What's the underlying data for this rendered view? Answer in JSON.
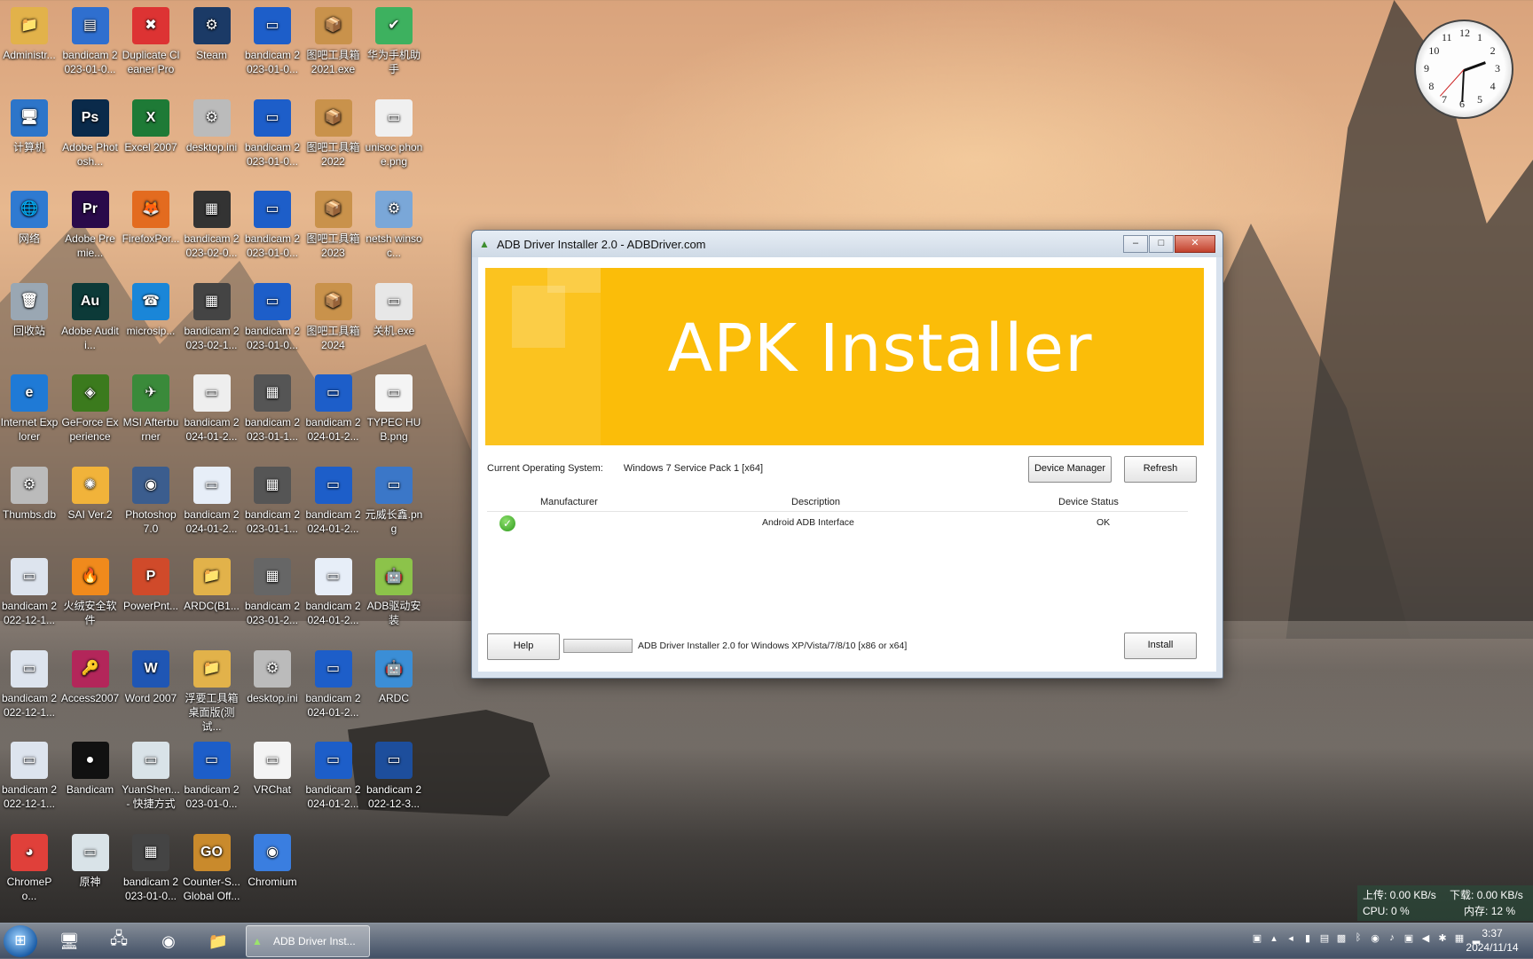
{
  "desktop": {
    "icons": [
      {
        "label": "Administr...",
        "glyph": "📁",
        "bg": "#e2b24a"
      },
      {
        "label": "bandicam 2023-01-0...",
        "glyph": "▤",
        "bg": "#2f6fcf"
      },
      {
        "label": "Duplicate Cleaner Pro",
        "glyph": "✖",
        "bg": "#d33"
      },
      {
        "label": "Steam",
        "glyph": "⚙",
        "bg": "#1b3a66"
      },
      {
        "label": "bandicam 2023-01-0...",
        "glyph": "▭",
        "bg": "#1d5ec9"
      },
      {
        "label": "图吧工具箱 2021.exe",
        "glyph": "📦",
        "bg": "#c9924b"
      },
      {
        "label": "华为手机助手",
        "glyph": "✔",
        "bg": "#3db15f"
      },
      {
        "label": "计算机",
        "glyph": "🖥",
        "bg": "#2d75c9"
      },
      {
        "label": "Adobe Photosh...",
        "glyph": "Ps",
        "bg": "#0a2a4a"
      },
      {
        "label": "Excel 2007",
        "glyph": "X",
        "bg": "#1e7a36"
      },
      {
        "label": "desktop.ini",
        "glyph": "⚙",
        "bg": "#bbbbbb"
      },
      {
        "label": "bandicam 2023-01-0...",
        "glyph": "▭",
        "bg": "#1d5ec9"
      },
      {
        "label": "图吧工具箱 2022",
        "glyph": "📦",
        "bg": "#c9924b"
      },
      {
        "label": "unisoc phone.png",
        "glyph": "▭",
        "bg": "#f0f0f0"
      },
      {
        "label": "网络",
        "glyph": "🌐",
        "bg": "#2f7ad1"
      },
      {
        "label": "Adobe Premie...",
        "glyph": "Pr",
        "bg": "#2a0a4a"
      },
      {
        "label": "FirefoxPor...",
        "glyph": "🦊",
        "bg": "#e36b1f"
      },
      {
        "label": "bandicam 2023-02-0...",
        "glyph": "▦",
        "bg": "#333"
      },
      {
        "label": "bandicam 2023-01-0...",
        "glyph": "▭",
        "bg": "#1d5ec9"
      },
      {
        "label": "图吧工具箱 2023",
        "glyph": "📦",
        "bg": "#c9924b"
      },
      {
        "label": "netsh winsoc...",
        "glyph": "⚙",
        "bg": "#7aa7d8"
      },
      {
        "label": "回收站",
        "glyph": "🗑",
        "bg": "#9aa7b3"
      },
      {
        "label": "Adobe Auditi...",
        "glyph": "Au",
        "bg": "#0c3a38"
      },
      {
        "label": "microsip...",
        "glyph": "☎",
        "bg": "#1a86d8"
      },
      {
        "label": "bandicam 2023-02-1...",
        "glyph": "▦",
        "bg": "#444"
      },
      {
        "label": "bandicam 2023-01-0...",
        "glyph": "▭",
        "bg": "#1d5ec9"
      },
      {
        "label": "图吧工具箱 2024",
        "glyph": "📦",
        "bg": "#c9924b"
      },
      {
        "label": "关机.exe",
        "glyph": "▭",
        "bg": "#e7e7e7"
      },
      {
        "label": "Internet Explorer",
        "glyph": "e",
        "bg": "#1f7ad6"
      },
      {
        "label": "GeForce Experience",
        "glyph": "◈",
        "bg": "#3b7a1d"
      },
      {
        "label": "MSI Afterburner",
        "glyph": "✈",
        "bg": "#3a8a3a"
      },
      {
        "label": "bandicam 2024-01-2...",
        "glyph": "▭",
        "bg": "#eeeeee"
      },
      {
        "label": "bandicam 2023-01-1...",
        "glyph": "▦",
        "bg": "#555"
      },
      {
        "label": "bandicam 2024-01-2...",
        "glyph": "▭",
        "bg": "#1d5ec9"
      },
      {
        "label": "TYPEC HUB.png",
        "glyph": "▭",
        "bg": "#f4f4f4"
      },
      {
        "label": "Thumbs.db",
        "glyph": "⚙",
        "bg": "#bbbbbb"
      },
      {
        "label": "SAI Ver.2",
        "glyph": "✺",
        "bg": "#f1b33a"
      },
      {
        "label": "Photoshop 7.0",
        "glyph": "◉",
        "bg": "#3b5d8e"
      },
      {
        "label": "bandicam 2024-01-2...",
        "glyph": "▭",
        "bg": "#e7eef8"
      },
      {
        "label": "bandicam 2023-01-1...",
        "glyph": "▦",
        "bg": "#555"
      },
      {
        "label": "bandicam 2024-01-2...",
        "glyph": "▭",
        "bg": "#1d5ec9"
      },
      {
        "label": "元威长鑫.png",
        "glyph": "▭",
        "bg": "#3b77c8"
      },
      {
        "label": "bandicam 2022-12-1...",
        "glyph": "▭",
        "bg": "#dde4ee"
      },
      {
        "label": "火绒安全软件",
        "glyph": "🔥",
        "bg": "#f08a1c"
      },
      {
        "label": "PowerPnt...",
        "glyph": "P",
        "bg": "#d04a2a"
      },
      {
        "label": "ARDC(B1...",
        "glyph": "📁",
        "bg": "#e2b24a"
      },
      {
        "label": "bandicam 2023-01-2...",
        "glyph": "▦",
        "bg": "#666"
      },
      {
        "label": "bandicam 2024-01-2...",
        "glyph": "▭",
        "bg": "#e7eef8"
      },
      {
        "label": "ADB驱动安装",
        "glyph": "🤖",
        "bg": "#8cc34a"
      },
      {
        "label": "bandicam 2022-12-1...",
        "glyph": "▭",
        "bg": "#dde4ee"
      },
      {
        "label": "Access2007",
        "glyph": "🔑",
        "bg": "#b3265a"
      },
      {
        "label": "Word 2007",
        "glyph": "W",
        "bg": "#1f56b4"
      },
      {
        "label": "浮要工具箱桌面版(测试...",
        "glyph": "📁",
        "bg": "#e2b24a"
      },
      {
        "label": "desktop.ini",
        "glyph": "⚙",
        "bg": "#bbbbbb"
      },
      {
        "label": "bandicam 2024-01-2...",
        "glyph": "▭",
        "bg": "#1d5ec9"
      },
      {
        "label": "ARDC",
        "glyph": "🤖",
        "bg": "#3b8ed6"
      },
      {
        "label": "bandicam 2022-12-1...",
        "glyph": "▭",
        "bg": "#dde4ee"
      },
      {
        "label": "Bandicam",
        "glyph": "●",
        "bg": "#111"
      },
      {
        "label": "YuanShen... - 快捷方式",
        "glyph": "▭",
        "bg": "#d9e3e8"
      },
      {
        "label": "bandicam 2023-01-0...",
        "glyph": "▭",
        "bg": "#1d5ec9"
      },
      {
        "label": "VRChat",
        "glyph": "▭",
        "bg": "#f4f4f4"
      },
      {
        "label": "bandicam 2024-01-2...",
        "glyph": "▭",
        "bg": "#1d5ec9"
      },
      {
        "label": "bandicam 2022-12-3...",
        "glyph": "▭",
        "bg": "#1d4e9c"
      },
      {
        "label": "ChromePo...",
        "glyph": "◕",
        "bg": "#e0403a"
      },
      {
        "label": "原神",
        "glyph": "▭",
        "bg": "#d9e3e8"
      },
      {
        "label": "bandicam 2023-01-0...",
        "glyph": "▦",
        "bg": "#444"
      },
      {
        "label": "Counter-S... Global Off...",
        "glyph": "GO",
        "bg": "#c98a2c"
      },
      {
        "label": "Chromium",
        "glyph": "◉",
        "bg": "#3a7ee0"
      }
    ]
  },
  "window": {
    "title": "ADB Driver Installer 2.0 - ADBDriver.com",
    "controls": {
      "minimize": "–",
      "maximize": "□",
      "close": "✕"
    },
    "banner_text": "APK Installer",
    "os_label": "Current Operating System:",
    "os_value": "Windows 7 Service Pack 1 [x64]",
    "device_manager_label": "Device Manager",
    "refresh_label": "Refresh",
    "columns": {
      "manufacturer": "Manufacturer",
      "description": "Description",
      "status": "Device Status"
    },
    "rows": [
      {
        "manufacturer": "",
        "description": "Android ADB Interface",
        "status": "OK"
      }
    ],
    "help_label": "Help",
    "footer_text": "ADB Driver Installer 2.0 for Windows XP/Vista/7/8/10 [x86 or x64]",
    "install_label": "Install"
  },
  "clock_gadget": {
    "numbers": [
      "12",
      "1",
      "2",
      "3",
      "4",
      "5",
      "6",
      "7",
      "8",
      "9",
      "10",
      "11"
    ]
  },
  "net_monitor": {
    "upload": "上传: 0.00 KB/s",
    "download": "下载: 0.00 KB/s",
    "cpu": "CPU: 0 %",
    "memory": "内存: 12 %"
  },
  "taskbar": {
    "task_label": "ADB Driver Inst...",
    "time": "3:37",
    "date": "2024/11/14"
  },
  "colors": {
    "banner": "#fbbd09",
    "ok_green": "#2e9a1c"
  }
}
